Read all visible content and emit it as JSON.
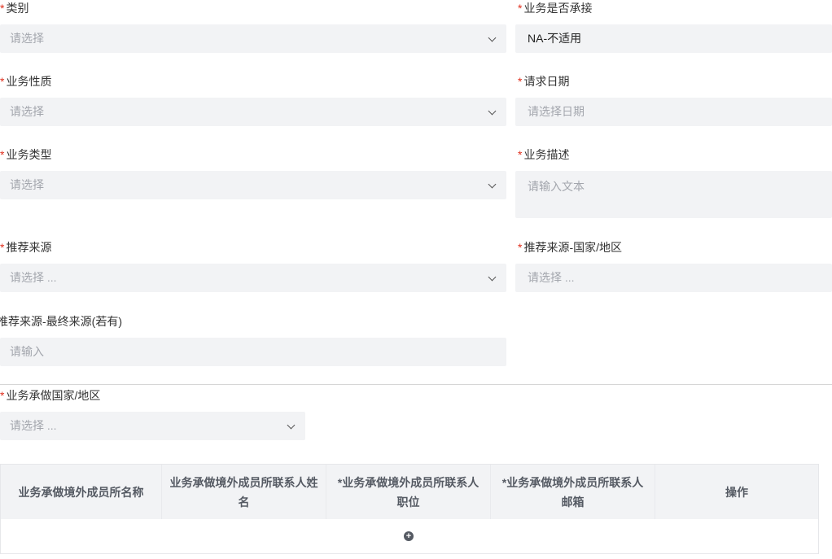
{
  "form": {
    "category": {
      "label": "类别",
      "placeholder": "请选择"
    },
    "business_accepted": {
      "label": "业务是否承接",
      "value": "NA-不适用"
    },
    "business_nature": {
      "label": "业务性质",
      "placeholder": "请选择"
    },
    "request_date": {
      "label": "请求日期",
      "placeholder": "请选择日期"
    },
    "business_type": {
      "label": "业务类型",
      "placeholder": "请选择"
    },
    "business_description": {
      "label": "业务描述",
      "placeholder": "请输入文本"
    },
    "referral_source": {
      "label": "推荐来源",
      "placeholder": "请选择 ..."
    },
    "referral_source_country": {
      "label": "推荐来源-国家/地区",
      "placeholder": "请选择 ..."
    },
    "referral_final_source": {
      "label": "推荐来源-最终来源(若有)",
      "placeholder": "请输入"
    },
    "undertaking_country": {
      "label": "业务承做国家/地区",
      "placeholder": "请选择 ..."
    }
  },
  "required_mark": "*",
  "table": {
    "columns": [
      "业务承做境外成员所名称",
      "业务承做境外成员所联系人姓名",
      "*业务承做境外成员所联系人职位",
      "*业务承做境外成员所联系人邮箱",
      "操作"
    ],
    "add_icon": "plus-circle-icon",
    "add_symbol": "+"
  }
}
